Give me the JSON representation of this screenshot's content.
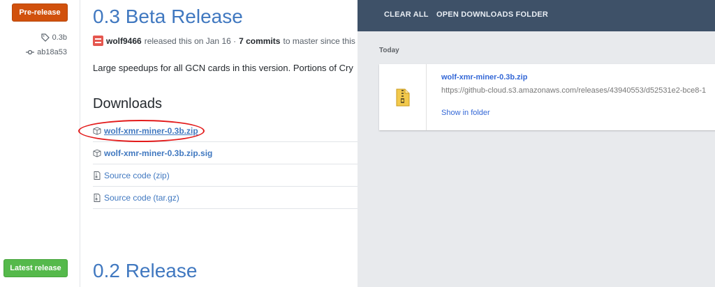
{
  "github": {
    "sidebar": {
      "pre_release_label": "Pre-release",
      "tag": "0.3b",
      "commit": "ab18a53",
      "latest_release_label": "Latest release"
    },
    "release": {
      "title": "0.3 Beta Release",
      "author": "wolf9466",
      "released_text": "released this on Jan 16 ·",
      "commits": "7 commits",
      "commits_suffix": "to master since this re",
      "description": "Large speedups for all GCN cards in this version. Portions of Cry"
    },
    "downloads": {
      "heading": "Downloads",
      "items": [
        {
          "name": "wolf-xmr-miner-0.3b.zip"
        },
        {
          "name": "wolf-xmr-miner-0.3b.zip.sig"
        },
        {
          "name": "Source code",
          "ext": "(zip)"
        },
        {
          "name": "Source code",
          "ext": "(tar.gz)"
        }
      ]
    },
    "next_release_title": "0.2 Release"
  },
  "downloads_page": {
    "toolbar": {
      "clear_all": "CLEAR ALL",
      "open_folder": "OPEN DOWNLOADS FOLDER"
    },
    "day_label": "Today",
    "item": {
      "file_name": "wolf-xmr-miner-0.3b.zip",
      "url": "https://github-cloud.s3.amazonaws.com/releases/43940553/d52531e2-bce8-1",
      "show_in_folder": "Show in folder",
      "icon": "zip-archive-icon"
    }
  },
  "colors": {
    "pre_release": "#d1510d",
    "latest_release": "#55b94b",
    "link": "#4078c0",
    "downloads_bar": "#3e5168",
    "annotation": "#e31b1b"
  }
}
